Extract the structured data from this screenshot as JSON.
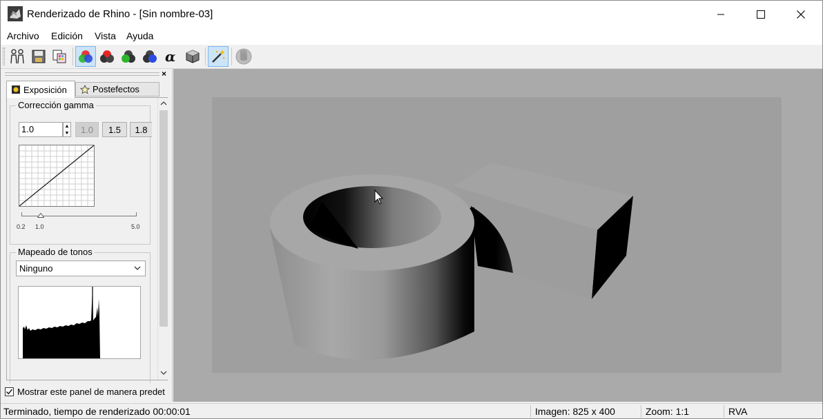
{
  "window": {
    "title": "Renderizado de Rhino - [Sin nombre-03]"
  },
  "menu": {
    "items": [
      "Archivo",
      "Edición",
      "Vista",
      "Ayuda"
    ]
  },
  "toolbar": {
    "buttons": [
      {
        "icon": "people-icon"
      },
      {
        "icon": "save-icon"
      },
      {
        "icon": "copy-image-icon"
      },
      {
        "icon": "rgb-channels-icon",
        "pressed": true
      },
      {
        "icon": "red-channel-icon"
      },
      {
        "icon": "green-channel-icon"
      },
      {
        "icon": "blue-channel-icon"
      },
      {
        "icon": "alpha-channel-icon"
      },
      {
        "icon": "depth-box-icon"
      },
      {
        "icon": "magic-wand-icon",
        "pressed": true
      },
      {
        "icon": "hand-icon",
        "disabled": true
      }
    ]
  },
  "panel": {
    "close_label": "×",
    "tabs": [
      {
        "label": "Exposición",
        "icon": "exposure-icon",
        "active": true
      },
      {
        "label": "Postefectos",
        "icon": "star-icon",
        "active": false
      }
    ],
    "gamma": {
      "title": "Corrección gamma",
      "value": "1.0",
      "presets": [
        "1.0",
        "1.5",
        "1.8"
      ],
      "slider_min": "0.2",
      "slider_mid": "1.0",
      "slider_max": "5.0"
    },
    "tonemap": {
      "title": "Mapeado de tonos",
      "selected": "Ninguno"
    },
    "show_default": {
      "label": "Mostrar este panel de manera predet",
      "checked": true
    }
  },
  "status": {
    "message": "Terminado, tiempo de renderizado 00:00:01",
    "image": "Imagen: 825 x 400",
    "zoom": "Zoom: 1:1",
    "channel": "RVA"
  },
  "colors": {
    "viewport_bg": "#aaaaaa",
    "render_bg": "#9f9f9f",
    "pressed_btn": "#cce4f7"
  }
}
